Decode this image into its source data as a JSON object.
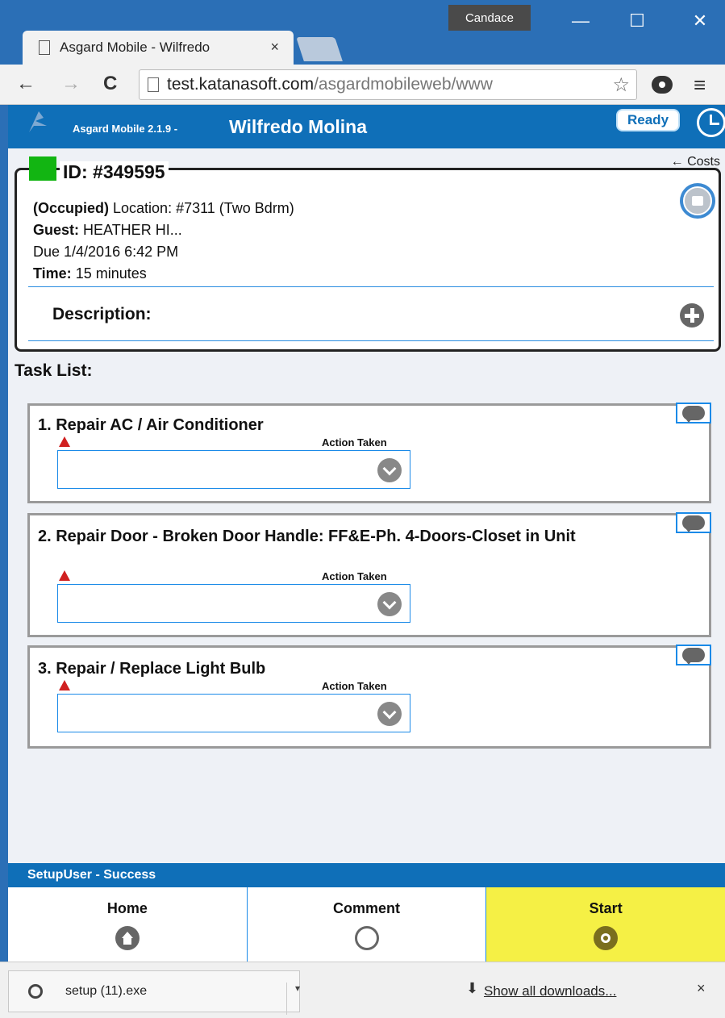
{
  "browser": {
    "user_badge": "Candace",
    "tab_title": "Asgard Mobile - Wilfredo",
    "tab_close": "×",
    "url_host": "test.katanasoft.com",
    "url_path": "/asgardmobileweb/www"
  },
  "app": {
    "version": "Asgard Mobile 2.1.9 -",
    "user_name": "Wilfredo Molina",
    "ready_label": "Ready"
  },
  "work_order": {
    "costs_link": "← Costs",
    "id_label": "ID: #349595",
    "occupancy": "(Occupied)",
    "location": " Location: #7311 (Two Bdrm)",
    "guest_label": "Guest:",
    "guest_value": " HEATHER HI...",
    "due": "Due 1/4/2016 6:42 PM",
    "time_label": "Time:",
    "time_value": " 15 minutes",
    "description_label": "Description:",
    "status_color": "#12b512"
  },
  "task_list": {
    "title": "Task List:",
    "action_label": "Action Taken",
    "tasks": [
      {
        "title": "1. Repair AC / Air Conditioner"
      },
      {
        "title": "2. Repair Door - Broken Door Handle: FF&E-Ph. 4-Doors-Closet in Unit"
      },
      {
        "title": "3. Repair / Replace Light Bulb"
      }
    ]
  },
  "status_bar": {
    "message": "SetupUser - Success"
  },
  "bottom_nav": {
    "home": "Home",
    "comment": "Comment",
    "start": "Start"
  },
  "downloads": {
    "file_name": "setup (11).exe",
    "show_all": "Show all downloads...",
    "close": "×"
  },
  "colors": {
    "brand_blue": "#0f6fb8",
    "start_yellow": "#f5f045",
    "alert_red": "#d02020"
  }
}
